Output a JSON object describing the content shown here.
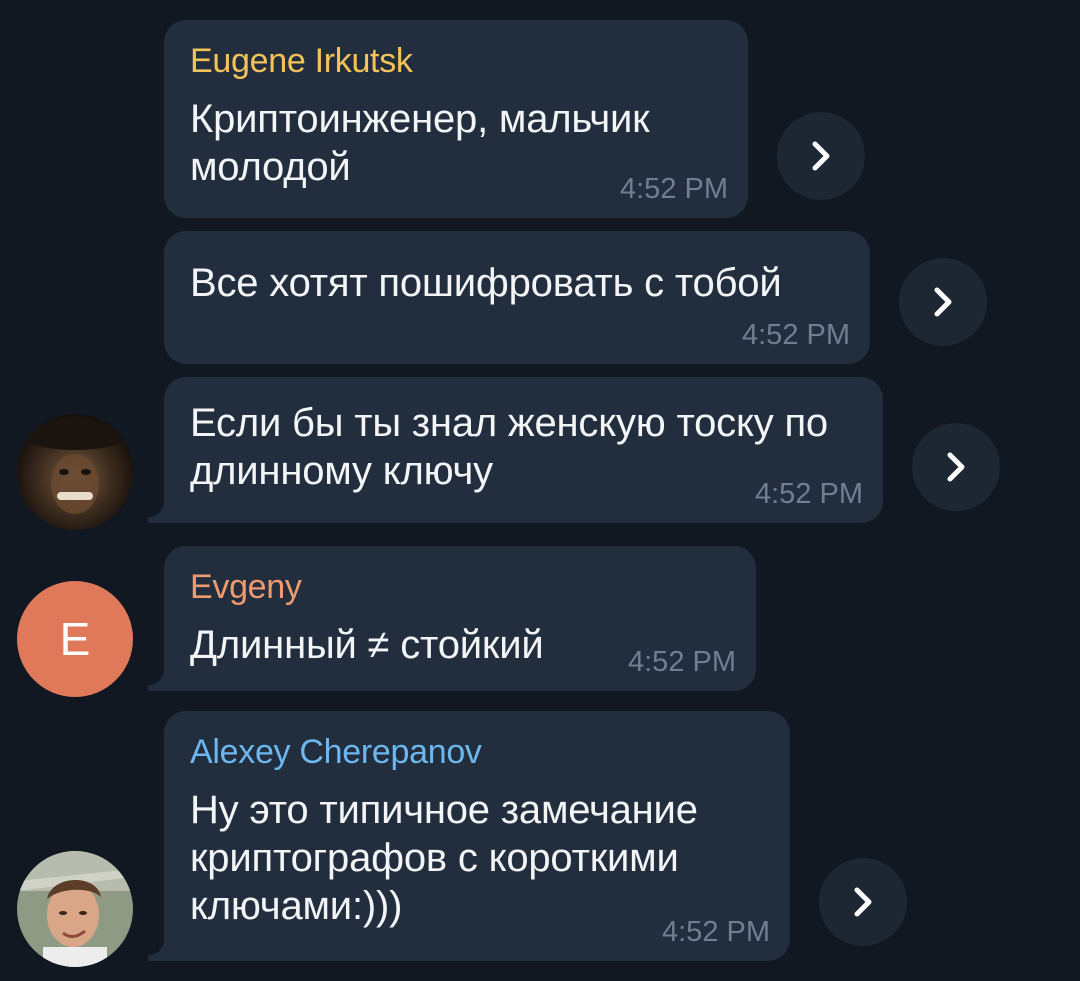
{
  "messages": [
    {
      "sender": "Eugene Irkutsk",
      "sender_color": "#f3c259",
      "text": "Криптоинженер, мальчик молодой",
      "time": "4:52 PM"
    },
    {
      "text": "Все хотят пошифровать с тобой",
      "time": "4:52 PM"
    },
    {
      "text": "Если бы ты знал женскую тоску по длинному ключу",
      "time": "4:52 PM"
    },
    {
      "sender": "Evgeny",
      "sender_color": "#f09a6f",
      "avatar_letter": "E",
      "avatar_color": "#e0785a",
      "text": "Длинный ≠ стойкий",
      "time": "4:52 PM"
    },
    {
      "sender": "Alexey Cherepanov",
      "sender_color": "#6cb7ef",
      "text": "Ну это типичное замечание криптографов с короткими ключами:)))",
      "time": "4:52 PM"
    }
  ],
  "icons": {
    "forward": "chevron-right-icon"
  },
  "colors": {
    "background": "#111821",
    "bubble": "#222e3d",
    "text": "#f2f4f6",
    "time": "#6f7f91",
    "forward_button": "#1d2733"
  }
}
